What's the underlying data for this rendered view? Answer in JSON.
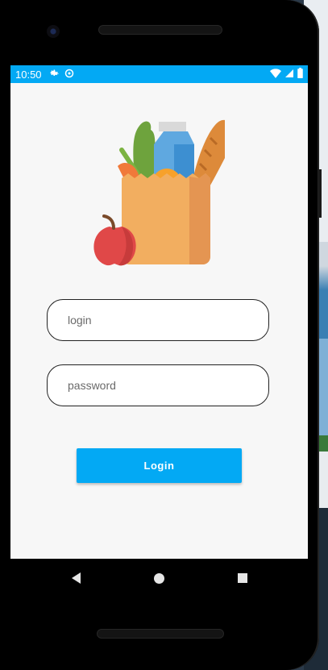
{
  "status_bar": {
    "time": "10:50",
    "icons": [
      "gear-icon",
      "sync-icon",
      "wifi-icon",
      "signal-icon",
      "battery-icon"
    ],
    "color": "#03a9f4"
  },
  "login_form": {
    "login_placeholder": "login",
    "password_placeholder": "password",
    "login_button_label": "Login",
    "button_color": "#03a9f4"
  },
  "navigation": {
    "buttons": [
      "back",
      "home",
      "recents"
    ]
  }
}
